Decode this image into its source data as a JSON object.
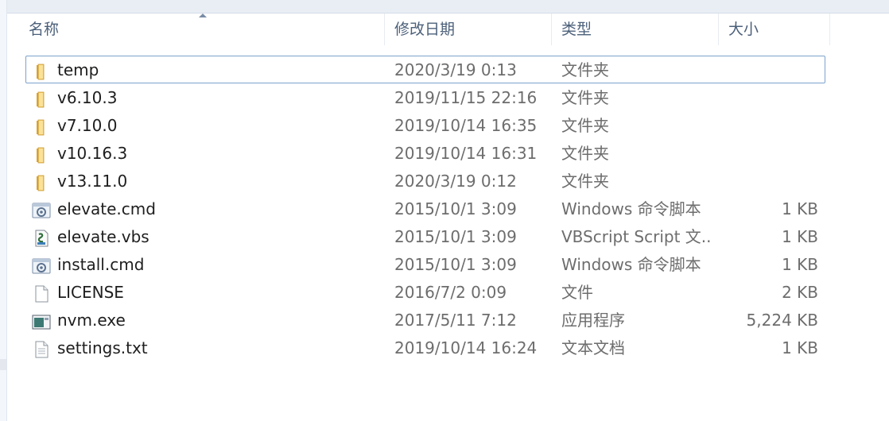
{
  "columns": {
    "name": "名称",
    "date": "修改日期",
    "type": "类型",
    "size": "大小"
  },
  "files": [
    {
      "name": "temp",
      "date": "2020/3/19 0:13",
      "type": "文件夹",
      "size": "",
      "icon": "folder-icon",
      "selected": true
    },
    {
      "name": "v6.10.3",
      "date": "2019/11/15 22:16",
      "type": "文件夹",
      "size": "",
      "icon": "folder-icon"
    },
    {
      "name": "v7.10.0",
      "date": "2019/10/14 16:35",
      "type": "文件夹",
      "size": "",
      "icon": "folder-icon"
    },
    {
      "name": "v10.16.3",
      "date": "2019/10/14 16:31",
      "type": "文件夹",
      "size": "",
      "icon": "folder-icon"
    },
    {
      "name": "v13.11.0",
      "date": "2020/3/19 0:12",
      "type": "文件夹",
      "size": "",
      "icon": "folder-icon"
    },
    {
      "name": "elevate.cmd",
      "date": "2015/10/1 3:09",
      "type": "Windows 命令脚本",
      "size": "1 KB",
      "icon": "cmd-script-icon"
    },
    {
      "name": "elevate.vbs",
      "date": "2015/10/1 3:09",
      "type": "VBScript Script 文...",
      "size": "1 KB",
      "icon": "vbs-script-icon"
    },
    {
      "name": "install.cmd",
      "date": "2015/10/1 3:09",
      "type": "Windows 命令脚本",
      "size": "1 KB",
      "icon": "cmd-script-icon"
    },
    {
      "name": "LICENSE",
      "date": "2016/7/2 0:09",
      "type": "文件",
      "size": "2 KB",
      "icon": "blank-file-icon"
    },
    {
      "name": "nvm.exe",
      "date": "2017/5/11 7:12",
      "type": "应用程序",
      "size": "5,224 KB",
      "icon": "exe-app-icon"
    },
    {
      "name": "settings.txt",
      "date": "2019/10/14 16:24",
      "type": "文本文档",
      "size": "1 KB",
      "icon": "text-file-icon"
    }
  ],
  "colors": {
    "header_text": "#4c607a",
    "selection_border": "#7da2ce",
    "folder": "#e8b84a"
  }
}
